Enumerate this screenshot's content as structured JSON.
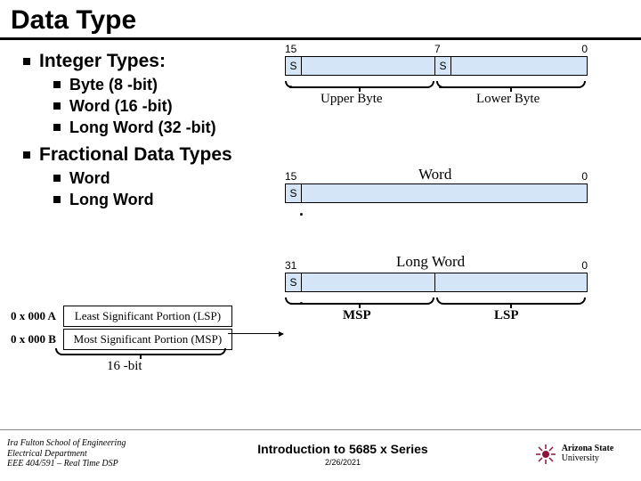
{
  "title": "Data Type",
  "integer": {
    "heading": "Integer Types:",
    "items": [
      "Byte (8 -bit)",
      "Word (16 -bit)",
      "Long Word (32 -bit)"
    ]
  },
  "fractional": {
    "heading": "Fractional Data Types",
    "items": [
      "Word",
      "Long Word"
    ]
  },
  "diag1": {
    "bit15": "15",
    "bit7": "7",
    "bit0": "0",
    "sign": "S",
    "upper": "Upper Byte",
    "lower": "Lower Byte"
  },
  "diag2": {
    "bit15": "15",
    "bit0": "0",
    "sign": "S",
    "label": "Word"
  },
  "diag3": {
    "bit31": "31",
    "bit0": "0",
    "sign": "S",
    "label": "Long Word",
    "msp": "MSP",
    "lsp": "LSP"
  },
  "table": {
    "addr1": "0 x 000 A",
    "lsp": "Least Significant Portion (LSP)",
    "addr2": "0 x 000 B",
    "msp": "Most Significant Portion (MSP)",
    "sixteen": "16 -bit"
  },
  "footer": {
    "school": "Ira Fulton School of Engineering",
    "dept": "Electrical Department",
    "course": "EEE 404/591 – Real Time DSP",
    "intro": "Introduction to 5685 x Series",
    "date": "2/26/2021",
    "asu1": "Arizona State",
    "asu2": "University"
  }
}
